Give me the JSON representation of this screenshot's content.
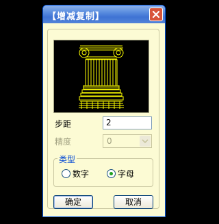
{
  "dialog": {
    "title": "【增减复制】",
    "close_icon": "close-icon"
  },
  "form": {
    "step_label": "步距",
    "step_value": "2",
    "precision_label": "精度",
    "precision_value": "0"
  },
  "type_group": {
    "title": "类型",
    "options": [
      {
        "label": "数字",
        "selected": false
      },
      {
        "label": "字母",
        "selected": true
      }
    ]
  },
  "buttons": {
    "ok_label": "确定",
    "cancel_label": "取消"
  },
  "colors": {
    "preview_line": "#ffff00",
    "title_bar": "#3f73d4",
    "dialog_bg": "#fcfbd4"
  }
}
